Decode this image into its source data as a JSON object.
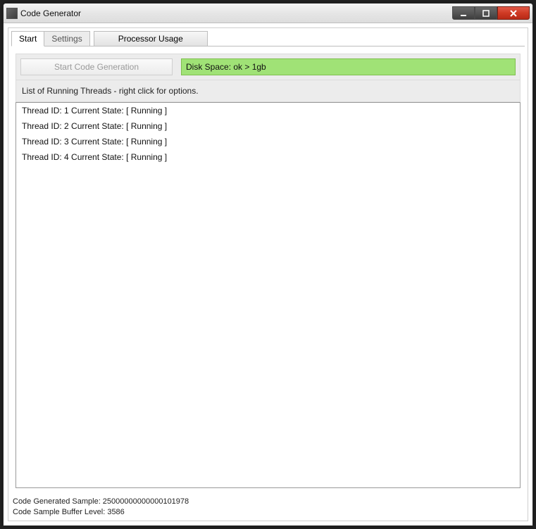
{
  "window": {
    "title": "Code Generator"
  },
  "tabs": {
    "start": "Start",
    "settings": "Settings",
    "processor_usage": "Processor Usage"
  },
  "toolbar": {
    "start_button_label": "Start Code Generation",
    "disk_space_label": "Disk Space: ok > 1gb"
  },
  "list_header": "List of Running Threads - right click for options.",
  "threads": [
    "Thread ID: 1 Current State: [ Running ]",
    "Thread ID: 2 Current State: [ Running ]",
    "Thread ID: 3 Current State: [ Running ]",
    "Thread ID: 4 Current State: [ Running ]"
  ],
  "status": {
    "line1": "Code Generated Sample: 25000000000000101978",
    "line2": "Code Sample Buffer Level: 3586"
  },
  "colors": {
    "disk_ok_bg": "#a0e276",
    "disk_ok_border": "#7fbf4f"
  }
}
